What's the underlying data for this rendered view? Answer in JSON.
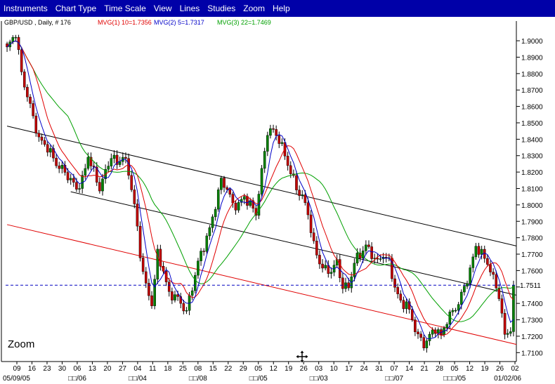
{
  "menu": [
    "Instruments",
    "Chart Type",
    "Time Scale",
    "View",
    "Lines",
    "Studies",
    "Zoom",
    "Help"
  ],
  "legend": {
    "instrument": "GBP/USD , Daily, # 176",
    "mvg1": "MVG(1) 10=1.7356",
    "mvg2": "MVG(2) 5=1.7317",
    "mvg3": "MVG(3) 22=1.7469"
  },
  "zoom_label": "Zoom",
  "colors": {
    "menubar": "#0000a8",
    "mvg1": "#e00000",
    "mvg2": "#0000c8",
    "mvg3": "#00a000",
    "up": "#008000",
    "down": "#c00000",
    "last_price_line": "#0000c0"
  },
  "chart_data": {
    "type": "candlestick",
    "instrument": "GBP/USD",
    "period": "Daily",
    "bars": 176,
    "ylim": [
      1.705,
      1.912
    ],
    "y_ticks": [
      "1.9000",
      "1.8900",
      "1.8800",
      "1.8700",
      "1.8600",
      "1.8500",
      "1.8400",
      "1.8300",
      "1.8200",
      "1.8100",
      "1.8000",
      "1.7900",
      "1.7800",
      "1.7700",
      "1.7600",
      "1.7500",
      "1.7400",
      "1.7300",
      "1.7200",
      "1.7100"
    ],
    "last_price": "1.7511",
    "x_ticks_upper": [
      "09",
      "16",
      "23",
      "30",
      "06",
      "13",
      "20",
      "27",
      "04",
      "11",
      "18",
      "25",
      "08",
      "15",
      "22",
      "29",
      "05",
      "12",
      "19",
      "26",
      "03",
      "10",
      "17",
      "24",
      "31",
      "07",
      "14",
      "21",
      "28",
      "05",
      "12",
      "19",
      "26",
      "02"
    ],
    "x_ticks_lower": [
      "05/09/05",
      "□□/06",
      "□□/04",
      "□□/08",
      "□□/05",
      "□□/03",
      "□□/07",
      "□□□/05",
      "01/02/06"
    ],
    "close_path": [
      [
        0,
        1.895
      ],
      [
        3,
        1.905
      ],
      [
        5,
        1.88
      ],
      [
        8,
        1.86
      ],
      [
        11,
        1.84
      ],
      [
        14,
        1.835
      ],
      [
        17,
        1.825
      ],
      [
        20,
        1.82
      ],
      [
        22,
        1.815
      ],
      [
        24,
        1.81
      ],
      [
        26,
        1.815
      ],
      [
        28,
        1.83
      ],
      [
        30,
        1.82
      ],
      [
        32,
        1.81
      ],
      [
        34,
        1.82
      ],
      [
        36,
        1.83
      ],
      [
        38,
        1.825
      ],
      [
        40,
        1.83
      ],
      [
        42,
        1.82
      ],
      [
        44,
        1.8
      ],
      [
        46,
        1.77
      ],
      [
        48,
        1.75
      ],
      [
        50,
        1.74
      ],
      [
        52,
        1.77
      ],
      [
        54,
        1.76
      ],
      [
        56,
        1.745
      ],
      [
        58,
        1.745
      ],
      [
        60,
        1.74
      ],
      [
        62,
        1.735
      ],
      [
        64,
        1.75
      ],
      [
        66,
        1.765
      ],
      [
        68,
        1.775
      ],
      [
        70,
        1.785
      ],
      [
        72,
        1.8
      ],
      [
        74,
        1.815
      ],
      [
        76,
        1.81
      ],
      [
        78,
        1.8
      ],
      [
        80,
        1.8
      ],
      [
        82,
        1.805
      ],
      [
        84,
        1.8
      ],
      [
        86,
        1.795
      ],
      [
        88,
        1.82
      ],
      [
        90,
        1.845
      ],
      [
        92,
        1.845
      ],
      [
        94,
        1.84
      ],
      [
        96,
        1.83
      ],
      [
        98,
        1.82
      ],
      [
        100,
        1.81
      ],
      [
        102,
        1.805
      ],
      [
        104,
        1.795
      ],
      [
        106,
        1.775
      ],
      [
        108,
        1.765
      ],
      [
        110,
        1.76
      ],
      [
        112,
        1.76
      ],
      [
        114,
        1.765
      ],
      [
        116,
        1.75
      ],
      [
        118,
        1.75
      ],
      [
        120,
        1.765
      ],
      [
        122,
        1.77
      ],
      [
        124,
        1.775
      ],
      [
        126,
        1.77
      ],
      [
        128,
        1.765
      ],
      [
        130,
        1.77
      ],
      [
        132,
        1.765
      ],
      [
        134,
        1.75
      ],
      [
        136,
        1.74
      ],
      [
        138,
        1.74
      ],
      [
        140,
        1.73
      ],
      [
        142,
        1.72
      ],
      [
        144,
        1.715
      ],
      [
        146,
        1.72
      ],
      [
        148,
        1.725
      ],
      [
        150,
        1.72
      ],
      [
        152,
        1.73
      ],
      [
        154,
        1.735
      ],
      [
        156,
        1.74
      ],
      [
        158,
        1.75
      ],
      [
        160,
        1.76
      ],
      [
        162,
        1.775
      ],
      [
        164,
        1.77
      ],
      [
        166,
        1.765
      ],
      [
        168,
        1.755
      ],
      [
        170,
        1.745
      ],
      [
        172,
        1.72
      ],
      [
        174,
        1.725
      ],
      [
        175,
        1.7511
      ]
    ],
    "mvg_periods": {
      "mvg1": 10,
      "mvg2": 5,
      "mvg3": 22
    },
    "trend_lines": [
      {
        "color": "black",
        "from": [
          0,
          1.848
        ],
        "to": [
          176,
          1.775
        ]
      },
      {
        "color": "black",
        "from": [
          22,
          1.808
        ],
        "to": [
          176,
          1.745
        ]
      },
      {
        "color": "red",
        "from": [
          0,
          1.788
        ],
        "to": [
          176,
          1.715
        ]
      }
    ],
    "grid": false,
    "legend_position": "top-left"
  }
}
